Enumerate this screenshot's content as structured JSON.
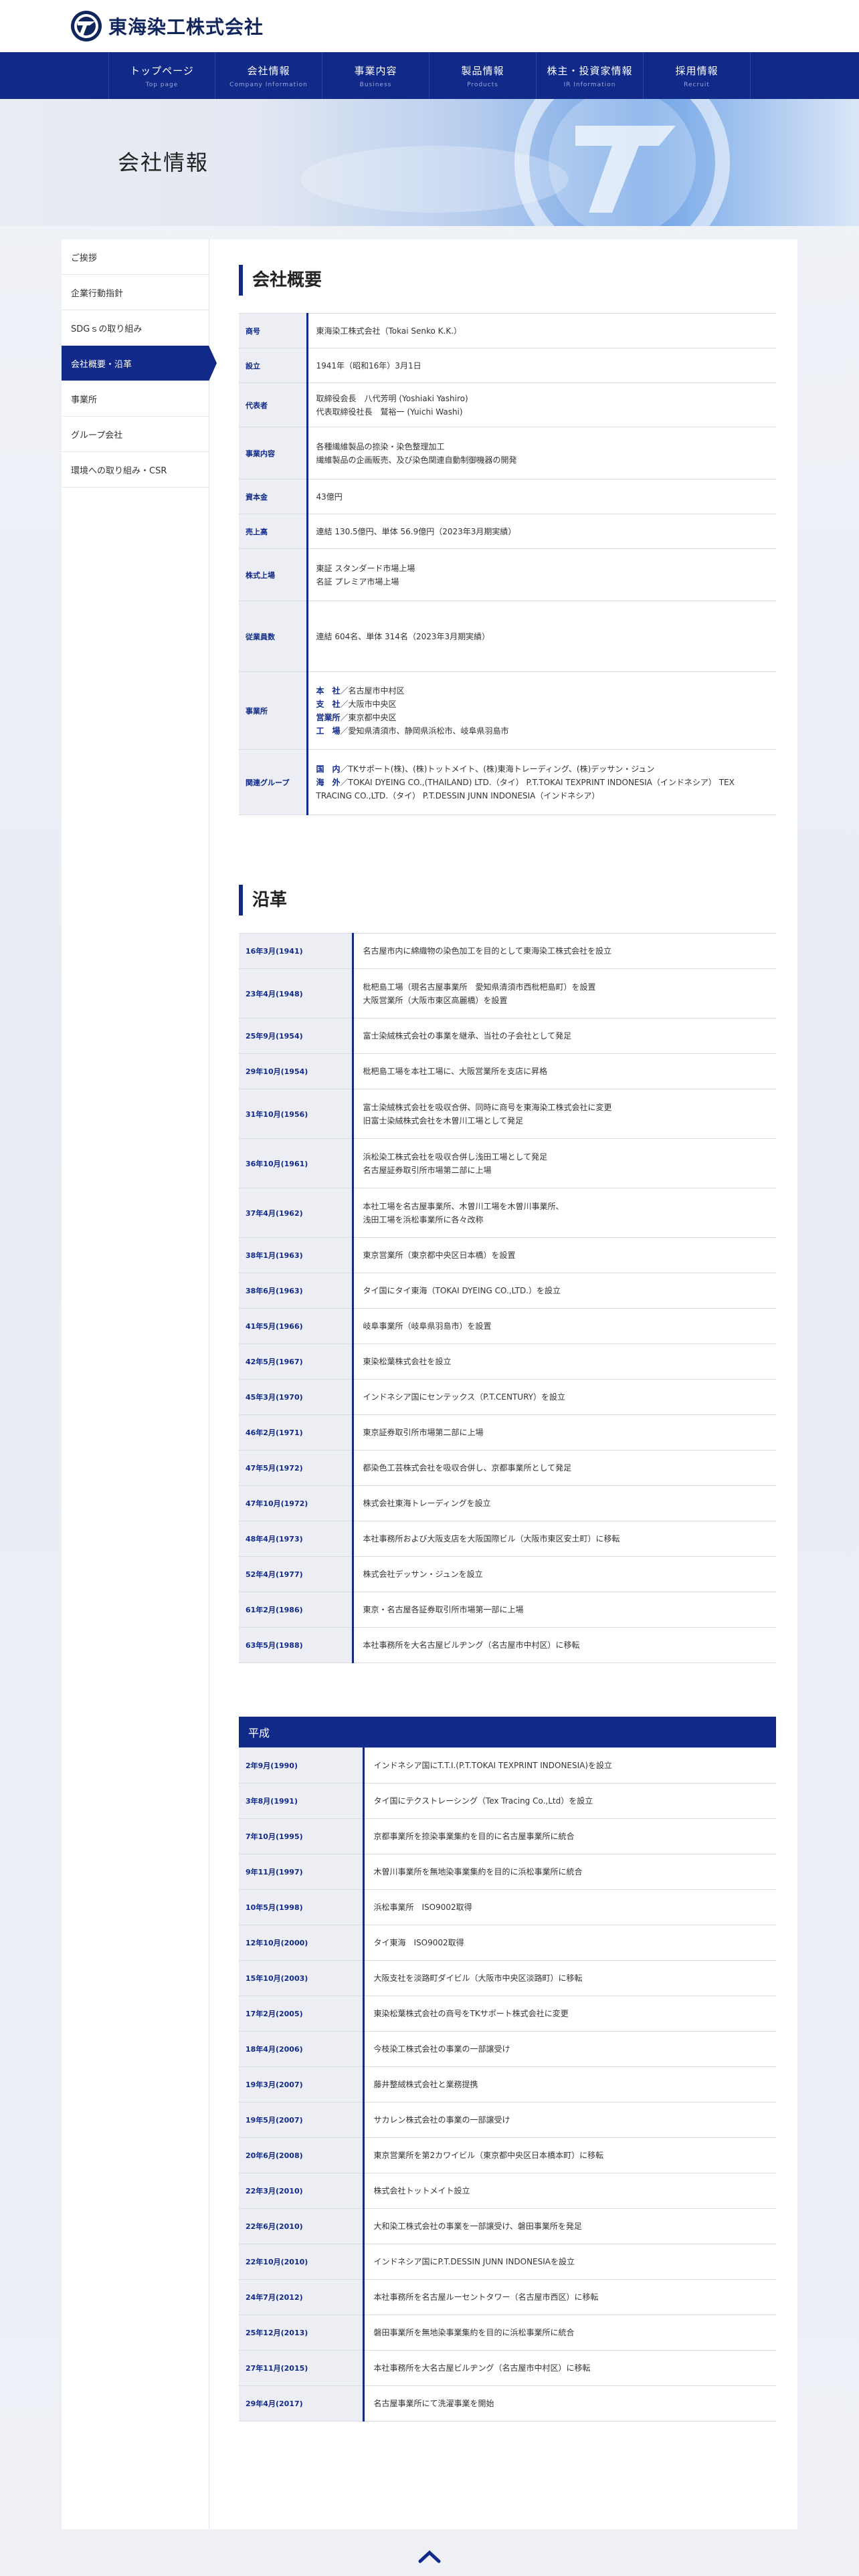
{
  "brand": {
    "name": "東海染工株式会社",
    "accent": "#112a8a"
  },
  "nav": [
    {
      "jp": "トップページ",
      "en": "Top page"
    },
    {
      "jp": "会社情報",
      "en": "Company Information"
    },
    {
      "jp": "事業内容",
      "en": "Business"
    },
    {
      "jp": "製品情報",
      "en": "Products"
    },
    {
      "jp": "株主・投資家情報",
      "en": "IR Information"
    },
    {
      "jp": "採用情報",
      "en": "Recruit"
    }
  ],
  "hero": {
    "title": "会社情報"
  },
  "sidenav": [
    "ご挨拶",
    "企業行動指針",
    "SDGｓの取り組み",
    "会社概要・沿革",
    "事業所",
    "グループ会社",
    "環境への取り組み・CSR"
  ],
  "profile": {
    "title": "会社概要",
    "rows": [
      {
        "label": "商号",
        "value": "東海染工株式会社（Tokai Senko K.K.）"
      },
      {
        "label": "設立",
        "value": "1941年（昭和16年）3月1日"
      },
      {
        "label": "代表者",
        "value": "取締役会長　八代芳明 (Yoshiaki Yashiro)\n代表取締役社長　鷲裕一 (Yuichi Washi)"
      },
      {
        "label": "事業内容",
        "value": "各種繊維製品の捺染・染色整理加工\n繊維製品の企画販売、及び染色関連自動制御機器の開発"
      },
      {
        "label": "資本金",
        "value": "43億円"
      },
      {
        "label": "売上高",
        "value": "連結 130.5億円、単体 56.9億円（2023年3月期実績）"
      },
      {
        "label": "株式上場",
        "value": "東証 スタンダード市場上場\n名証 プレミア市場上場"
      },
      {
        "label": "従業員数",
        "value": "連結 604名、単体 314名（2023年3月期実績）"
      },
      {
        "label": "事業所",
        "lines": [
          {
            "head": "本　社",
            "text": "／名古屋市中村区"
          },
          {
            "head": "支　社",
            "text": "／大阪市中央区"
          },
          {
            "head": "営業所",
            "text": "／東京都中央区"
          },
          {
            "head": "工　場",
            "text": "／愛知県清須市、静岡県浜松市、岐阜県羽島市"
          }
        ]
      },
      {
        "label": "関連グループ",
        "lines": [
          {
            "head": "国　内",
            "text": "／TKサポート(株)、(株)トットメイト、(株)東海トレーディング、(株)デッサン・ジュン"
          },
          {
            "head": "海　外",
            "text": "／TOKAI DYEING CO.,(THAILAND) LTD.（タイ） P.T.TOKAI TEXPRINT INDONESIA（インドネシア） TEX TRACING CO.,LTD.（タイ） P.T.DESSIN JUNN INDONESIA（インドネシア）"
          }
        ]
      }
    ]
  },
  "history": {
    "title": "沿革",
    "showa": [
      {
        "date": "16年3月(1941)",
        "text": "名古屋市内に綿織物の染色加工を目的として東海染工株式会社を設立"
      },
      {
        "date": "23年4月(1948)",
        "text": "枇杷島工場（現名古屋事業所　愛知県清須市西枇杷島町）を設置\n大阪営業所（大阪市東区高麗橋）を設置"
      },
      {
        "date": "25年9月(1954)",
        "text": "富士染絨株式会社の事業を継承、当社の子会社として発足"
      },
      {
        "date": "29年10月(1954)",
        "text": "枇杷島工場を本社工場に、大阪営業所を支店に昇格"
      },
      {
        "date": "31年10月(1956)",
        "text": "富士染絨株式会社を吸収合併、同時に商号を東海染工株式会社に変更\n旧富士染絨株式会社を木曽川工場として発足"
      },
      {
        "date": "36年10月(1961)",
        "text": "浜松染工株式会社を吸収合併し浅田工場として発足\n名古屋証券取引所市場第二部に上場"
      },
      {
        "date": "37年4月(1962)",
        "text": "本社工場を名古屋事業所、木曽川工場を木曽川事業所、\n浅田工場を浜松事業所に各々改称"
      },
      {
        "date": "38年1月(1963)",
        "text": "東京営業所（東京都中央区日本橋）を設置"
      },
      {
        "date": "38年6月(1963)",
        "text": "タイ国にタイ東海（TOKAI DYEING CO.,LTD.）を設立"
      },
      {
        "date": "41年5月(1966)",
        "text": "岐阜事業所（岐阜県羽島市）を設置"
      },
      {
        "date": "42年5月(1967)",
        "text": "東染松葉株式会社を設立"
      },
      {
        "date": "45年3月(1970)",
        "text": "インドネシア国にセンテックス（P.T.CENTURY）を設立"
      },
      {
        "date": "46年2月(1971)",
        "text": "東京証券取引所市場第二部に上場"
      },
      {
        "date": "47年5月(1972)",
        "text": "都染色工芸株式会社を吸収合併し、京都事業所として発足"
      },
      {
        "date": "47年10月(1972)",
        "text": "株式会社東海トレーディングを設立"
      },
      {
        "date": "48年4月(1973)",
        "text": "本社事務所および大阪支店を大阪国際ビル（大阪市東区安土町）に移転"
      },
      {
        "date": "52年4月(1977)",
        "text": "株式会社デッサン・ジュンを設立"
      },
      {
        "date": "61年2月(1986)",
        "text": "東京・名古屋各証券取引所市場第一部に上場"
      },
      {
        "date": "63年5月(1988)",
        "text": "本社事務所を大名古屋ビルヂング（名古屋市中村区）に移転"
      }
    ],
    "heisei_label": "平成",
    "heisei": [
      {
        "date": "2年9月(1990)",
        "text": "インドネシア国にT.T.I.(P.T.TOKAI TEXPRINT INDONESIA)を設立"
      },
      {
        "date": "3年8月(1991)",
        "text": "タイ国にテクストレーシング（Tex Tracing Co.,Ltd）を設立"
      },
      {
        "date": "7年10月(1995)",
        "text": "京都事業所を捺染事業集約を目的に名古屋事業所に統合"
      },
      {
        "date": "9年11月(1997)",
        "text": "木曽川事業所を無地染事業集約を目的に浜松事業所に統合"
      },
      {
        "date": "10年5月(1998)",
        "text": "浜松事業所　ISO9002取得"
      },
      {
        "date": "12年10月(2000)",
        "text": "タイ東海　ISO9002取得"
      },
      {
        "date": "15年10月(2003)",
        "text": "大阪支社を淡路町ダイビル（大阪市中央区淡路町）に移転"
      },
      {
        "date": "17年2月(2005)",
        "text": "東染松葉株式会社の商号をTKサポート株式会社に変更"
      },
      {
        "date": "18年4月(2006)",
        "text": "今枝染工株式会社の事業の一部譲受け"
      },
      {
        "date": "19年3月(2007)",
        "text": "藤井整絨株式会社と業務提携"
      },
      {
        "date": "19年5月(2007)",
        "text": "サカレン株式会社の事業の一部譲受け"
      },
      {
        "date": "20年6月(2008)",
        "text": "東京営業所を第2カワイビル（東京都中央区日本橋本町）に移転"
      },
      {
        "date": "22年3月(2010)",
        "text": "株式会社トットメイト設立"
      },
      {
        "date": "22年6月(2010)",
        "text": "大和染工株式会社の事業を一部譲受け、磐田事業所を発足"
      },
      {
        "date": "22年10月(2010)",
        "text": "インドネシア国にP.T.DESSIN JUNN INDONESIAを設立"
      },
      {
        "date": "24年7月(2012)",
        "text": "本社事務所を名古屋ルーセントタワー（名古屋市西区）に移転"
      },
      {
        "date": "25年12月(2013)",
        "text": "磐田事業所を無地染事業集約を目的に浜松事業所に統合"
      },
      {
        "date": "27年11月(2015)",
        "text": "本社事務所を大名古屋ビルヂング（名古屋市中村区）に移転"
      },
      {
        "date": "29年4月(2017)",
        "text": "名古屋事業所にて洗濯事業を開始"
      }
    ]
  }
}
